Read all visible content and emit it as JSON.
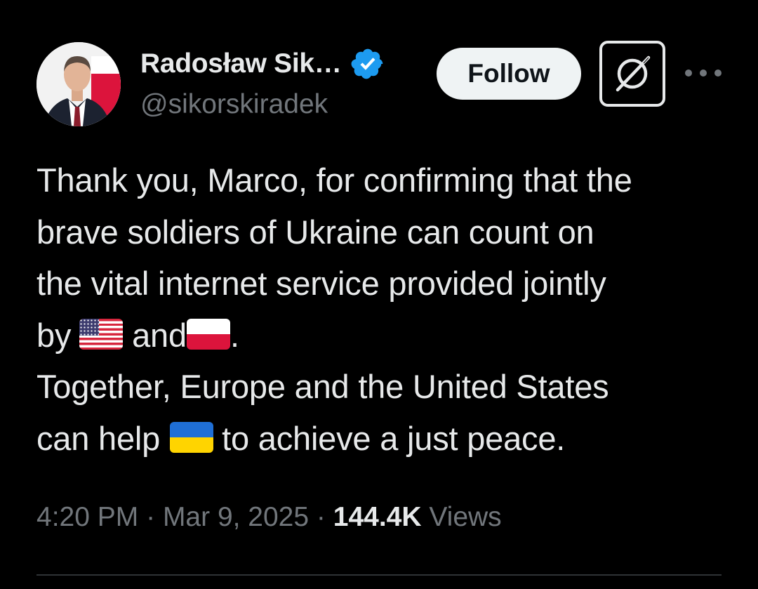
{
  "author": {
    "display_name": "Radosław Sik…",
    "handle": "@sikorskiradek",
    "verified_icon": "verified-badge-icon",
    "avatar_icon": "avatar"
  },
  "actions": {
    "follow_label": "Follow",
    "grok_icon": "grok-icon",
    "more_icon": "more-icon"
  },
  "tweet": {
    "line1": "Thank you, Marco, for confirming that the",
    "line2": "brave soldiers of Ukraine can count on",
    "line3": "the vital internet service provided jointly",
    "line4_before": "by",
    "line4_flag1": "flag-us",
    "line4_mid": "and",
    "line4_flag2": "flag-pl",
    "line4_after": ".",
    "line5": "Together, Europe and the United States",
    "line6_before": "can help",
    "line6_flag": "flag-ua",
    "line6_after": "to achieve a just peace."
  },
  "meta": {
    "time": "4:20 PM",
    "sep1": "·",
    "date": "Mar 9, 2025",
    "sep2": "·",
    "views_count": "144.4K",
    "views_label": "Views"
  },
  "colors": {
    "background": "#000000",
    "text_primary": "#e7e9ea",
    "text_secondary": "#71767b",
    "verified_blue": "#1d9bf0",
    "follow_bg": "#eff3f4"
  }
}
